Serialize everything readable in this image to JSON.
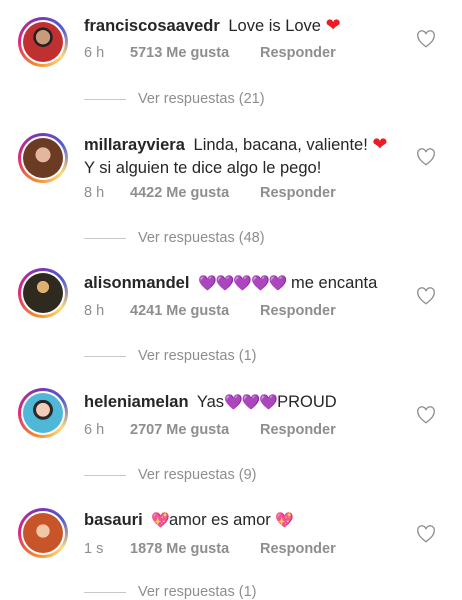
{
  "comments": [
    {
      "username": "franciscosaavedr",
      "text_before": "Love is Love",
      "emoji": "❤",
      "text_after": "",
      "time": "6 h",
      "likes": "5713 Me gusta",
      "reply": "Responder",
      "view_replies": "Ver respuestas (21)"
    },
    {
      "username": "millarayviera",
      "text_before": "Linda, bacana, valiente!",
      "emoji": "❤",
      "text_after": "Y si alguien te dice algo le pego!",
      "time": "8 h",
      "likes": "4422 Me gusta",
      "reply": "Responder",
      "view_replies": "Ver respuestas (48)"
    },
    {
      "username": "alisonmandel",
      "text_before": "",
      "emoji": "💜💜💜💜💜",
      "text_after": "me encanta",
      "time": "8 h",
      "likes": "4241 Me gusta",
      "reply": "Responder",
      "view_replies": "Ver respuestas (1)"
    },
    {
      "username": "heleniamelan",
      "text_before": "Yas",
      "emoji": "💜💜💜",
      "text_after": "PROUD",
      "time": "6 h",
      "likes": "2707 Me gusta",
      "reply": "Responder",
      "view_replies": "Ver respuestas (9)"
    },
    {
      "username": "basauri",
      "text_before": "",
      "emoji": "💖",
      "text_middle": "amor es amor",
      "emoji_end": "💖",
      "time": "1 s",
      "likes": "1878 Me gusta",
      "reply": "Responder",
      "view_replies": "Ver respuestas (1)"
    }
  ],
  "colors": {
    "text": "#262626",
    "muted": "#8e8e8e",
    "heart": "#ed1c24",
    "purple_heart": "#a020d8",
    "story_ring": "#dd2a7b"
  }
}
